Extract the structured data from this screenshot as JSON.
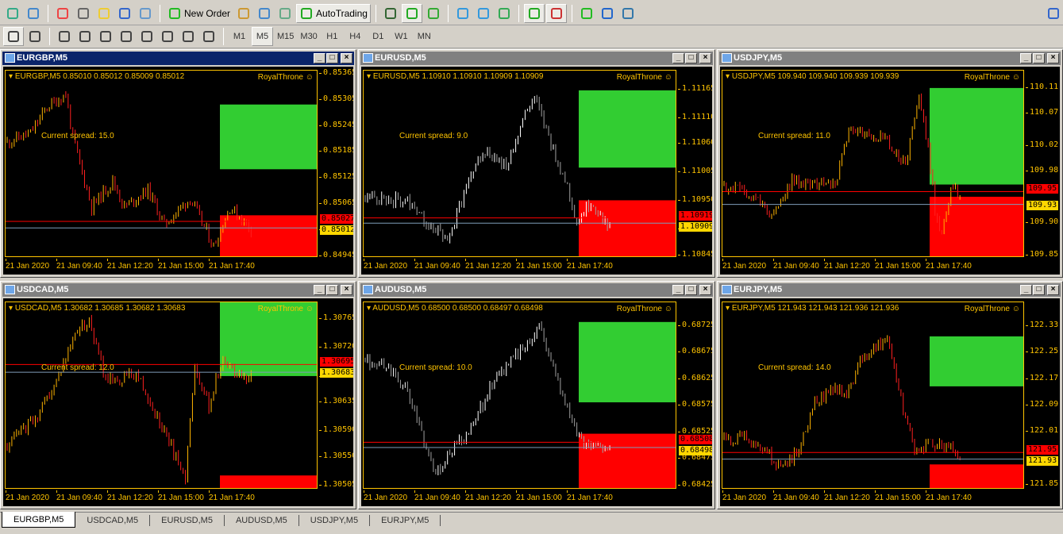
{
  "toolbar": {
    "new_order": "New Order",
    "autotrading": "AutoTrading",
    "icons": [
      "new-chart-icon",
      "profiles-icon",
      "market-watch-icon",
      "data-window-icon",
      "navigator-icon",
      "terminal-icon",
      "strategy-tester-icon",
      "new-order-icon",
      "metaeditor-icon",
      "signals-icon",
      "market-icon",
      "autotrading-icon",
      "bar-chart-icon",
      "candlestick-icon",
      "line-chart-icon",
      "zoom-in-icon",
      "zoom-out-icon",
      "tile-windows-icon",
      "auto-scroll-icon",
      "chart-shift-icon",
      "indicators-icon",
      "periods-icon",
      "templates-icon",
      "search-icon"
    ]
  },
  "drawing_tools": [
    "cursor-icon",
    "crosshair-icon",
    "vertical-line-icon",
    "horizontal-line-icon",
    "trendline-icon",
    "equidistant-channel-icon",
    "fibonacci-icon",
    "text-icon",
    "text-label-icon",
    "arrows-icon"
  ],
  "timeframes": [
    "M1",
    "M5",
    "M15",
    "M30",
    "H1",
    "H4",
    "D1",
    "W1",
    "MN"
  ],
  "active_timeframe": "M5",
  "colors": {
    "green_zone": "#32cd32",
    "red_zone": "#ff0000",
    "axis": "#ffc400",
    "ask_line": "#ff0000",
    "bid_line": "#7f9db9",
    "active_title": "#0a246a"
  },
  "charts": [
    {
      "title": "EURGBP,M5",
      "symbol": "EURGBP,M5",
      "ohlc": "0.85010 0.85012 0.85009 0.85012",
      "indicator": "RoyalThrone",
      "spread": "Current spread: 15.0",
      "active": true,
      "ylim": [
        0.84943,
        0.85374
      ],
      "ticks": [
        "0.85365",
        "0.85305",
        "0.85245",
        "0.85185",
        "0.85125",
        "0.85065",
        "0.85005",
        "0.84945"
      ],
      "ask": "0.85027",
      "bid": "0.85012",
      "green_zone": [
        0.85147,
        0.85296
      ],
      "red_zone": [
        0.84943,
        0.85041
      ],
      "candle_style": "color",
      "times": [
        "21 Jan 2020",
        "21 Jan 09:40",
        "21 Jan 12:20",
        "21 Jan 15:00",
        "21 Jan 17:40"
      ],
      "price_path": [
        [
          0,
          0.8521
        ],
        [
          10,
          0.8523
        ],
        [
          17,
          0.8529
        ],
        [
          25,
          0.8532
        ],
        [
          28,
          0.8522
        ],
        [
          36,
          0.8506
        ],
        [
          45,
          0.8512
        ],
        [
          50,
          0.8506
        ],
        [
          60,
          0.851
        ],
        [
          67,
          0.8502
        ],
        [
          78,
          0.8508
        ],
        [
          88,
          0.8497
        ],
        [
          95,
          0.8506
        ],
        [
          104,
          0.8501
        ]
      ]
    },
    {
      "title": "EURUSD,M5",
      "symbol": "EURUSD,M5",
      "ohlc": "1.10910 1.10910 1.10909 1.10909",
      "indicator": "RoyalThrone",
      "spread": "Current spread: 9.0",
      "active": false,
      "ylim": [
        1.10842,
        1.11203
      ],
      "ticks": [
        "1.11165",
        "1.11110",
        "1.11060",
        "1.11005",
        "1.10950",
        "1.10895",
        "1.10845"
      ],
      "ask": "1.10919",
      "bid": "1.10909",
      "green_zone": [
        1.11016,
        1.11165
      ],
      "red_zone": [
        1.10842,
        1.10953
      ],
      "candle_style": "mono",
      "times": [
        "21 Jan 2020",
        "21 Jan 09:40",
        "21 Jan 12:20",
        "21 Jan 15:00",
        "21 Jan 17:40"
      ],
      "price_path": [
        [
          0,
          1.1096
        ],
        [
          20,
          1.1095
        ],
        [
          28,
          1.109
        ],
        [
          36,
          1.1088
        ],
        [
          42,
          1.1097
        ],
        [
          50,
          1.1105
        ],
        [
          60,
          1.1102
        ],
        [
          68,
          1.1112
        ],
        [
          72,
          1.1115
        ],
        [
          80,
          1.1105
        ],
        [
          86,
          1.1098
        ],
        [
          90,
          1.1091
        ],
        [
          96,
          1.1095
        ],
        [
          104,
          1.109
        ]
      ]
    },
    {
      "title": "USDJPY,M5",
      "symbol": "USDJPY,M5",
      "ohlc": "109.940 109.940 109.939 109.939",
      "indicator": "RoyalThrone",
      "spread": "Current spread: 11.0",
      "active": false,
      "ylim": [
        109.847,
        110.138
      ],
      "ticks": [
        "110.11",
        "110.07",
        "110.02",
        "109.98",
        "109.90",
        "109.85"
      ],
      "ask": "109.95",
      "bid": "109.93",
      "green_zone": [
        109.961,
        110.111
      ],
      "red_zone": [
        109.847,
        109.942
      ],
      "candle_style": "color",
      "times": [
        "21 Jan 2020",
        "21 Jan 09:40",
        "21 Jan 12:20",
        "21 Jan 15:00",
        "21 Jan 17:40"
      ],
      "price_path": [
        [
          0,
          109.96
        ],
        [
          15,
          109.94
        ],
        [
          22,
          109.91
        ],
        [
          30,
          109.97
        ],
        [
          40,
          109.96
        ],
        [
          50,
          109.97
        ],
        [
          55,
          110.05
        ],
        [
          62,
          110.04
        ],
        [
          72,
          110.03
        ],
        [
          80,
          109.99
        ],
        [
          86,
          110.1
        ],
        [
          90,
          110.02
        ],
        [
          93,
          109.92
        ],
        [
          96,
          109.88
        ],
        [
          100,
          109.96
        ],
        [
          104,
          109.94
        ]
      ]
    },
    {
      "title": "USDCAD,M5",
      "symbol": "USDCAD,M5",
      "ohlc": "1.30682 1.30685 1.30682 1.30683",
      "indicator": "RoyalThrone",
      "spread": "Current spread: 12.0",
      "active": false,
      "ylim": [
        1.305,
        1.30792
      ],
      "ticks": [
        "1.30765",
        "1.30720",
        "1.30675",
        "1.30635",
        "1.30590",
        "1.30550",
        "1.30505"
      ],
      "ask": "1.30695",
      "bid": "1.30683",
      "green_zone": [
        1.30677,
        1.30792
      ],
      "red_zone": [
        1.305,
        1.30522
      ],
      "candle_style": "color",
      "times": [
        "21 Jan 2020",
        "21 Jan 09:40",
        "21 Jan 12:20",
        "21 Jan 15:00",
        "21 Jan 17:40"
      ],
      "price_path": [
        [
          0,
          1.3057
        ],
        [
          12,
          1.3061
        ],
        [
          20,
          1.3066
        ],
        [
          30,
          1.3075
        ],
        [
          35,
          1.3076
        ],
        [
          42,
          1.3067
        ],
        [
          55,
          1.3068
        ],
        [
          62,
          1.3063
        ],
        [
          72,
          1.3055
        ],
        [
          76,
          1.3052
        ],
        [
          80,
          1.3069
        ],
        [
          86,
          1.3063
        ],
        [
          92,
          1.3071
        ],
        [
          100,
          1.3067
        ],
        [
          104,
          1.3068
        ]
      ]
    },
    {
      "title": "AUDUSD,M5",
      "symbol": "AUDUSD,M5",
      "ohlc": "0.68500 0.68500 0.68497 0.68498",
      "indicator": "RoyalThrone",
      "spread": "Current spread: 10.0",
      "active": false,
      "ylim": [
        0.68419,
        0.68771
      ],
      "ticks": [
        "0.68725",
        "0.68675",
        "0.68625",
        "0.68575",
        "0.68525",
        "0.68475",
        "0.68425"
      ],
      "ask": "0.68508",
      "bid": "0.68498",
      "green_zone": [
        0.68583,
        0.68734
      ],
      "red_zone": [
        0.68419,
        0.68524
      ],
      "candle_style": "mono",
      "times": [
        "21 Jan 2020",
        "21 Jan 09:40",
        "21 Jan 12:20",
        "21 Jan 15:00",
        "21 Jan 17:40"
      ],
      "price_path": [
        [
          0,
          0.6866
        ],
        [
          10,
          0.6865
        ],
        [
          18,
          0.686
        ],
        [
          26,
          0.685
        ],
        [
          30,
          0.6845
        ],
        [
          38,
          0.685
        ],
        [
          45,
          0.6853
        ],
        [
          55,
          0.6863
        ],
        [
          62,
          0.6866
        ],
        [
          70,
          0.687
        ],
        [
          74,
          0.6873
        ],
        [
          80,
          0.6865
        ],
        [
          90,
          0.6852
        ],
        [
          96,
          0.685
        ],
        [
          104,
          0.685
        ]
      ]
    },
    {
      "title": "EURJPY,M5",
      "symbol": "EURJPY,M5",
      "ohlc": "121.943 121.943 121.936 121.936",
      "indicator": "RoyalThrone",
      "spread": "Current spread: 14.0",
      "active": false,
      "ylim": [
        121.838,
        122.404
      ],
      "ticks": [
        "122.33",
        "122.25",
        "122.17",
        "122.09",
        "122.01",
        "121.85"
      ],
      "ask": "121.95",
      "bid": "121.93",
      "green_zone": [
        122.15,
        122.301
      ],
      "red_zone": [
        121.838,
        121.914
      ],
      "candle_style": "color",
      "times": [
        "21 Jan 2020",
        "21 Jan 09:40",
        "21 Jan 12:20",
        "21 Jan 15:00",
        "21 Jan 17:40"
      ],
      "price_path": [
        [
          0,
          121.99
        ],
        [
          10,
          122.0
        ],
        [
          18,
          121.96
        ],
        [
          25,
          121.9
        ],
        [
          32,
          121.95
        ],
        [
          40,
          122.1
        ],
        [
          48,
          122.14
        ],
        [
          54,
          122.13
        ],
        [
          60,
          122.22
        ],
        [
          66,
          122.27
        ],
        [
          72,
          122.3
        ],
        [
          76,
          122.16
        ],
        [
          84,
          121.95
        ],
        [
          90,
          121.98
        ],
        [
          96,
          121.98
        ],
        [
          104,
          121.94
        ]
      ]
    }
  ],
  "tabs": [
    "EURGBP,M5",
    "USDCAD,M5",
    "EURUSD,M5",
    "AUDUSD,M5",
    "USDJPY,M5",
    "EURJPY,M5"
  ],
  "active_tab": "EURGBP,M5"
}
